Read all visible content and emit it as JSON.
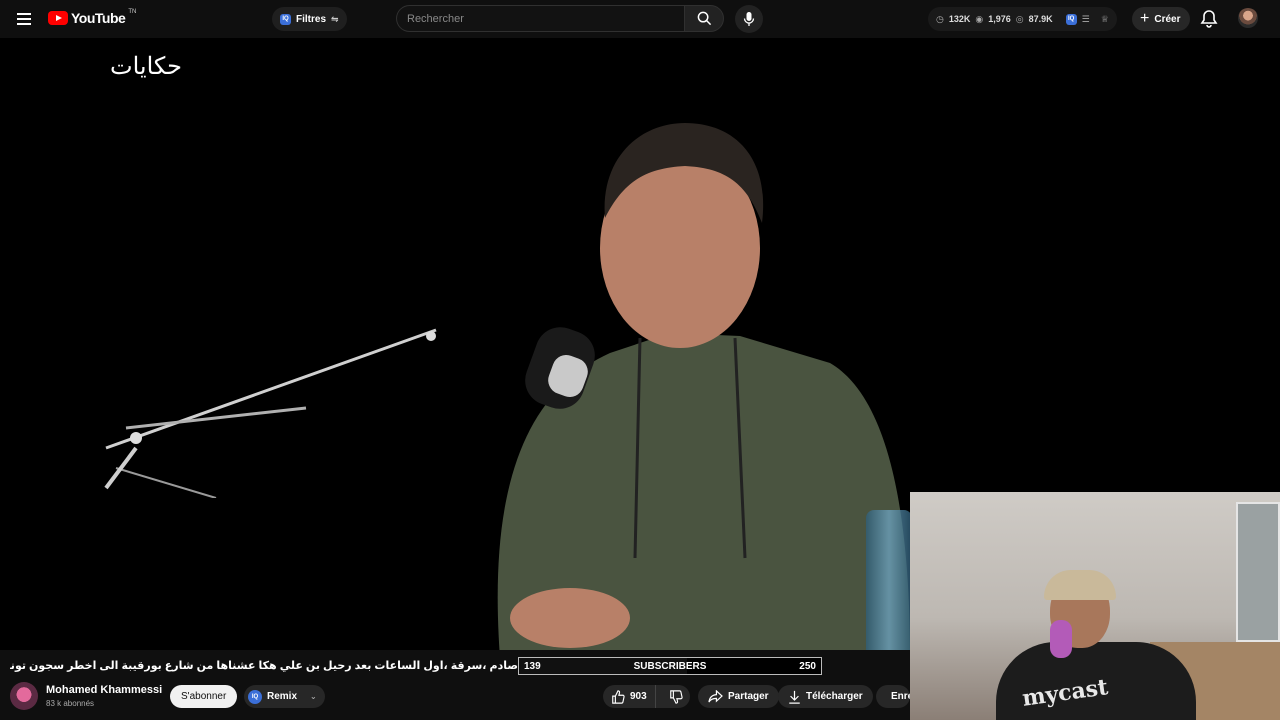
{
  "header": {
    "logo_text": "YouTube",
    "logo_tm": "TN",
    "filters_label": "Filtres",
    "filters_badge": "IQ",
    "search_placeholder": "Rechercher",
    "stats": {
      "views": "132K",
      "watched": "1,976",
      "seen": "87.9K",
      "badge": "IQ"
    },
    "create_label": "Créer"
  },
  "video": {
    "channel_watermark": "حكايات",
    "pip_shirt_text": "mycast"
  },
  "below_video": {
    "title": "صادم ،سرقة ،اول الساعات بعد رحيل بن علي هكا عشناها من شارع بورقيبة الى اخطر سجون تونس: محاولات هروب",
    "subscriber_bar": {
      "current": "139",
      "label": "SUBSCRIBERS",
      "goal": "250",
      "progress": 0.556
    },
    "channel_name": "Mohamed Khammessi",
    "channel_subs": "83 k abonnés",
    "subscribe_label": "S'abonner",
    "remix_label": "Remix",
    "remix_badge": "IQ",
    "like_count": "903",
    "share_label": "Partager",
    "download_label": "Télécharger",
    "save_label": "Enregistrer"
  },
  "colors": {
    "brand_red": "#ff0000",
    "background": "#0f0f0f",
    "pill": "#272727"
  }
}
